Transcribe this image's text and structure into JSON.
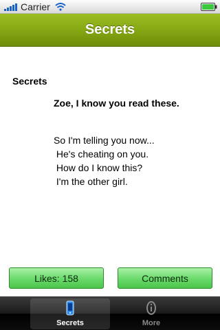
{
  "status_bar": {
    "carrier": "Carrier",
    "icons": [
      "signal-icon",
      "wifi-icon",
      "battery-icon"
    ]
  },
  "nav_bar": {
    "title": "Secrets",
    "color": "#86a814"
  },
  "content": {
    "section_title": "Secrets",
    "headline": "Zoe, I know you read these.",
    "body_lines": [
      "So I'm telling you now...",
      " He's cheating on you.",
      " How do I know this?",
      " I'm the other girl."
    ]
  },
  "actions": {
    "likes_label": "Likes: 158",
    "comments_label": "Comments",
    "button_color": "#69d96a"
  },
  "tab_bar": {
    "tabs": [
      {
        "label": "Secrets",
        "icon": "phone-icon",
        "selected": true
      },
      {
        "label": "More",
        "icon": "info-icon",
        "selected": false
      }
    ]
  }
}
